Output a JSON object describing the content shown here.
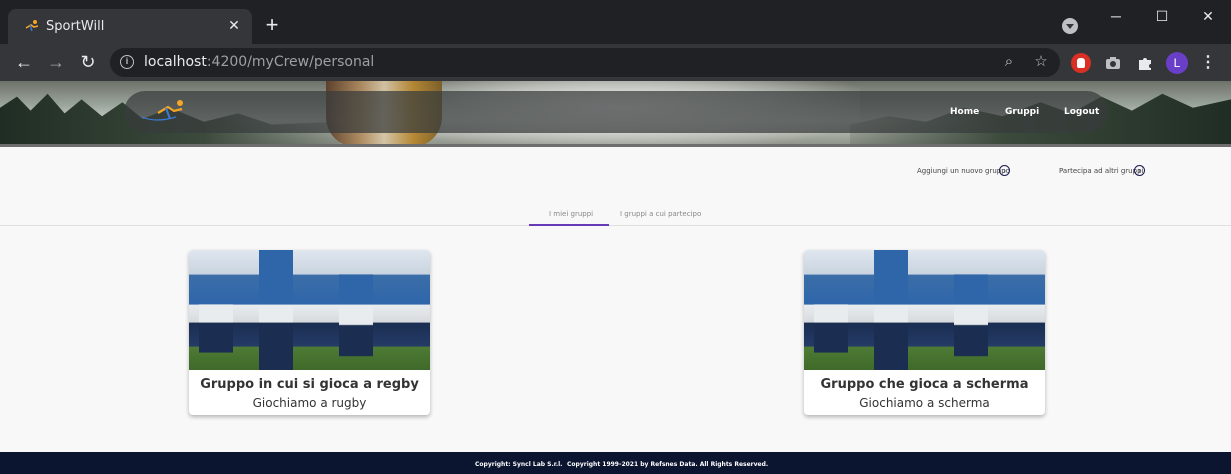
{
  "browser": {
    "tab_title": "SportWill",
    "url_host": "localhost",
    "url_path": ":4200/myCrew/personal",
    "avatar_letter": "L",
    "icons": [
      "back-icon",
      "forward-icon",
      "reload-icon",
      "info-icon",
      "zoom-icon",
      "star-icon",
      "stop-extension-icon",
      "camera-extension-icon",
      "puzzle-icon",
      "menu-icon"
    ]
  },
  "navbar": {
    "links": [
      "Home",
      "Gruppi",
      "Logout"
    ]
  },
  "actions": {
    "add_group": "Aggiungi un nuovo gruppo",
    "join_group": "Partecipa ad altri gruppi"
  },
  "tabs": [
    "I miei gruppi",
    "I gruppi a cui partecipo"
  ],
  "cards": [
    {
      "title": "Gruppo in cui si gioca a regby",
      "subtitle": "Giochiamo a rugby"
    },
    {
      "title": "Gruppo che gioca a scherma",
      "subtitle": "Giochiamo a scherma"
    }
  ],
  "footer": {
    "left": "Copyright: Syncl Lab S.r.l.",
    "right": "Copyright 1999-2021 by Refsnes Data. All Rights Reserved."
  },
  "colors": {
    "accent": "#673ab7",
    "footer_bg": "#0b1530",
    "chrome_dark": "#202124",
    "chrome_toolbar": "#35363a"
  }
}
